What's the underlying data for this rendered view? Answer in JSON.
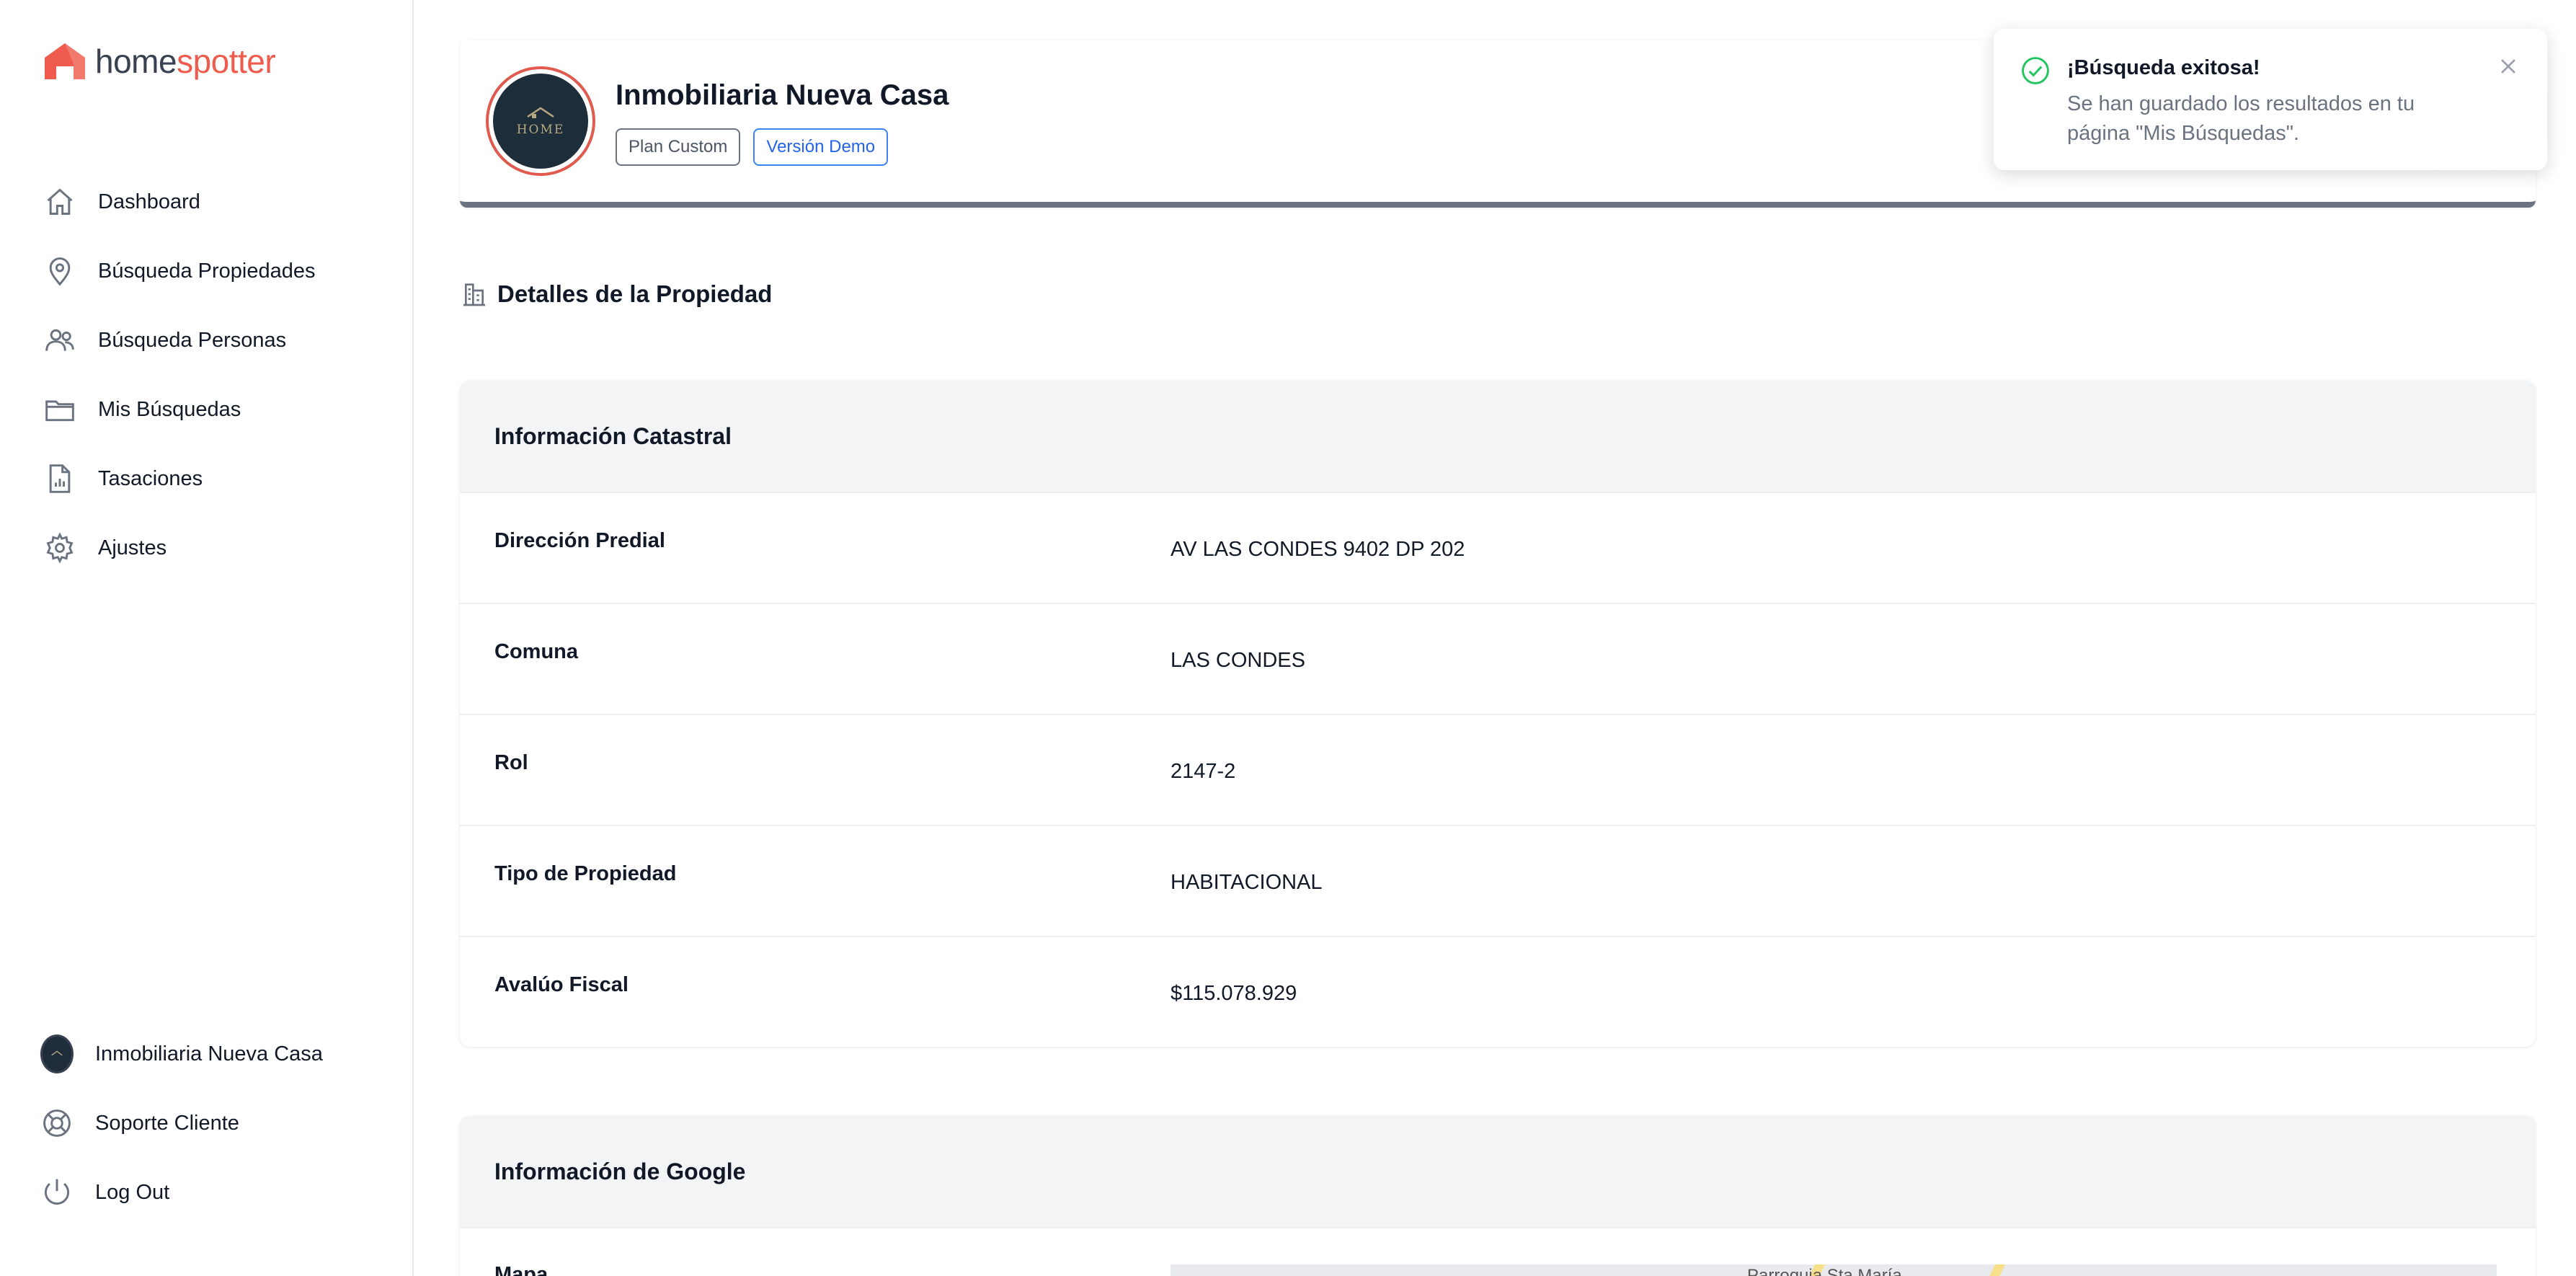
{
  "brand": {
    "name_part1": "home",
    "name_part2": "spotter",
    "accent": "#ef5b4c"
  },
  "sidebar": {
    "items": [
      {
        "label": "Dashboard",
        "icon": "home-icon"
      },
      {
        "label": "Búsqueda Propiedades",
        "icon": "map-pin-icon"
      },
      {
        "label": "Búsqueda Personas",
        "icon": "users-icon"
      },
      {
        "label": "Mis Búsquedas",
        "icon": "folder-icon"
      },
      {
        "label": "Tasaciones",
        "icon": "document-chart-icon"
      },
      {
        "label": "Ajustes",
        "icon": "gear-icon"
      }
    ],
    "bottom": [
      {
        "label": "Inmobiliaria Nueva Casa",
        "icon": "avatar"
      },
      {
        "label": "Soporte Cliente",
        "icon": "lifebuoy-icon"
      },
      {
        "label": "Log Out",
        "icon": "power-icon"
      }
    ]
  },
  "header": {
    "company_name": "Inmobiliaria Nueva Casa",
    "avatar_text": "HOME",
    "badges": [
      "Plan Custom",
      "Versión Demo"
    ]
  },
  "page": {
    "section_title": "Detalles de la Propiedad"
  },
  "catastral": {
    "title": "Información Catastral",
    "rows": [
      {
        "key": "Dirección Predial",
        "value": "AV LAS CONDES 9402 DP 202"
      },
      {
        "key": "Comuna",
        "value": "LAS CONDES"
      },
      {
        "key": "Rol",
        "value": "2147-2"
      },
      {
        "key": "Tipo de Propiedad",
        "value": "HABITACIONAL"
      },
      {
        "key": "Avalúo Fiscal",
        "value": "$115.078.929"
      }
    ]
  },
  "google": {
    "title": "Información de Google",
    "map_label": "Mapa",
    "map_place": "Parroquia Sta María"
  },
  "toast": {
    "title": "¡Búsqueda exitosa!",
    "body": "Se han guardado los resultados en tu página \"Mis Búsquedas\"."
  }
}
